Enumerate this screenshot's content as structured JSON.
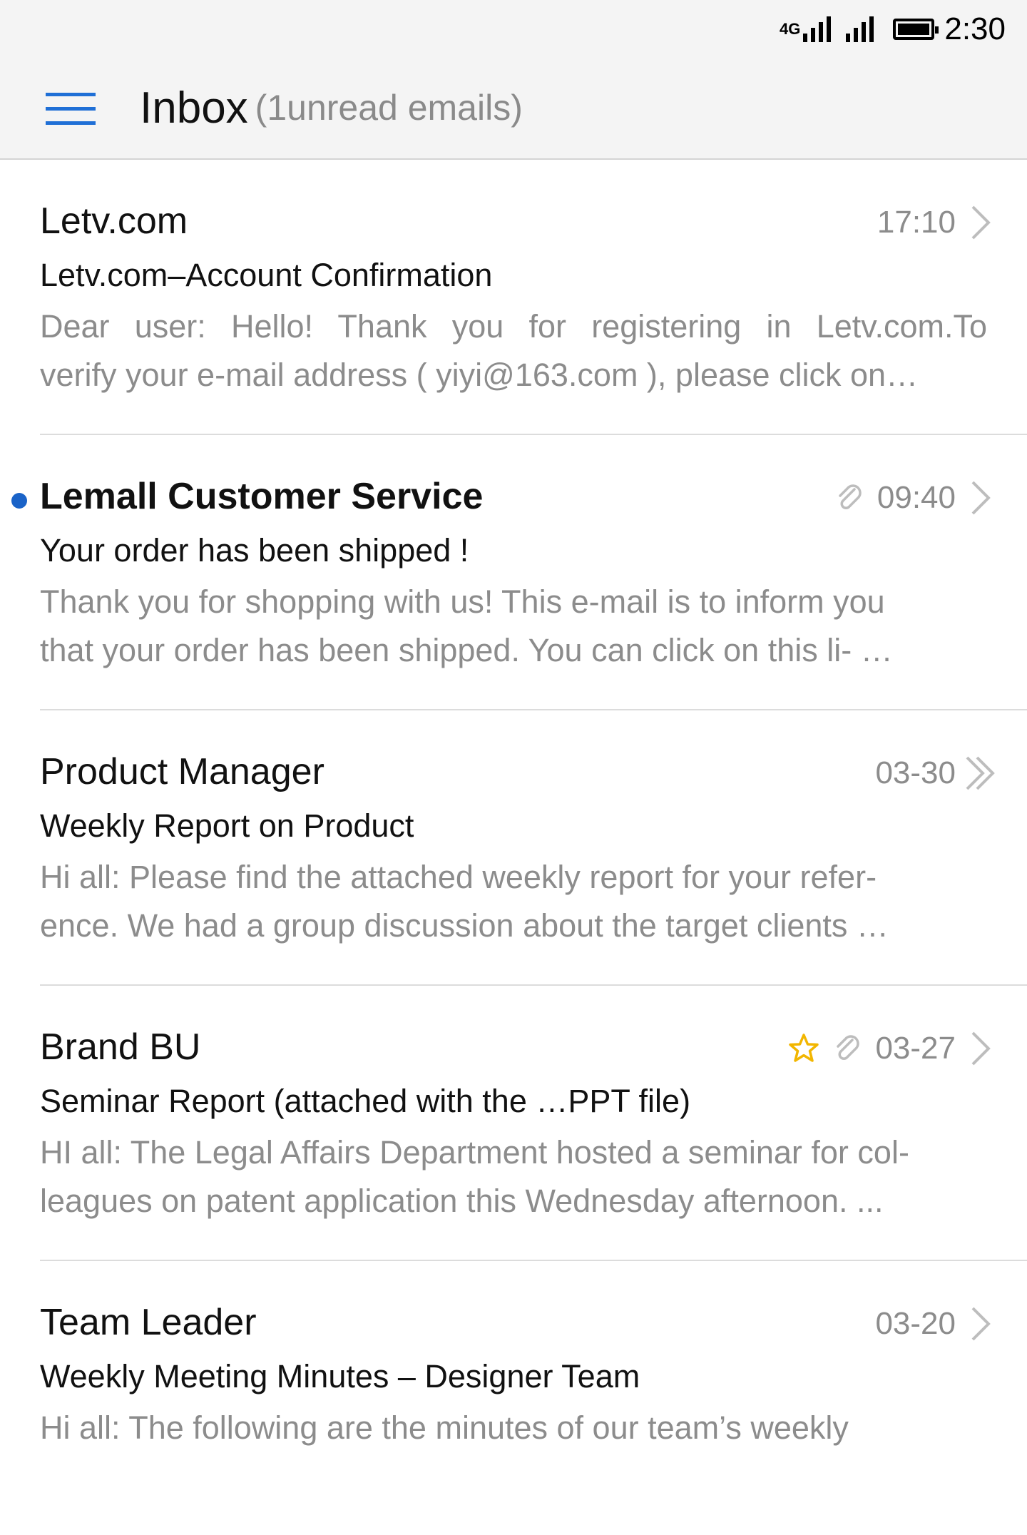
{
  "status_bar": {
    "network": "4G",
    "time": "2:30"
  },
  "header": {
    "title": "Inbox",
    "unread_count": "(1unread emails)"
  },
  "emails": [
    {
      "sender": "Letv.com",
      "time": "17:10",
      "subject": "Letv.com–Account Confirmation",
      "preview_line1": "Dear user: Hello! Thank you for registering in Letv.com.To",
      "preview_line2": "verify your e-mail address ( yiyi@163.com ), please click on…",
      "unread": false,
      "has_attachment": false,
      "starred": false
    },
    {
      "sender": "Lemall Customer Service",
      "time": "09:40",
      "subject": "Your order has been shipped !",
      "preview_line1": "Thank you for shopping with us! This e-mail is to inform you",
      "preview_line2": "that your order has been shipped. You can click on this li- …",
      "unread": true,
      "has_attachment": true,
      "starred": false
    },
    {
      "sender": "Product Manager",
      "time": "03-30",
      "subject": "Weekly Report on Product",
      "preview_line1": "Hi all: Please find the attached weekly report for your refer-",
      "preview_line2": "ence. We had a group discussion about the target clients …",
      "unread": false,
      "has_attachment": false,
      "starred": false
    },
    {
      "sender": "Brand BU",
      "time": "03-27",
      "subject": "Seminar Report (attached with the …PPT file)",
      "preview_line1": "HI all: The Legal Affairs Department hosted a seminar for col-",
      "preview_line2": "leagues on patent application this Wednesday afternoon. ...",
      "unread": false,
      "has_attachment": true,
      "starred": true
    },
    {
      "sender": "Team Leader",
      "time": "03-20",
      "subject": "Weekly Meeting Minutes – Designer Team",
      "preview_line1": "Hi all: The following are the minutes of our team’s weekly",
      "preview_line2": "",
      "unread": false,
      "has_attachment": false,
      "starred": false
    }
  ],
  "colors": {
    "accent": "#1f6fd6",
    "unread_dot": "#1a63c8",
    "star": "#f2b600",
    "secondary_text": "#8c8c8c"
  }
}
